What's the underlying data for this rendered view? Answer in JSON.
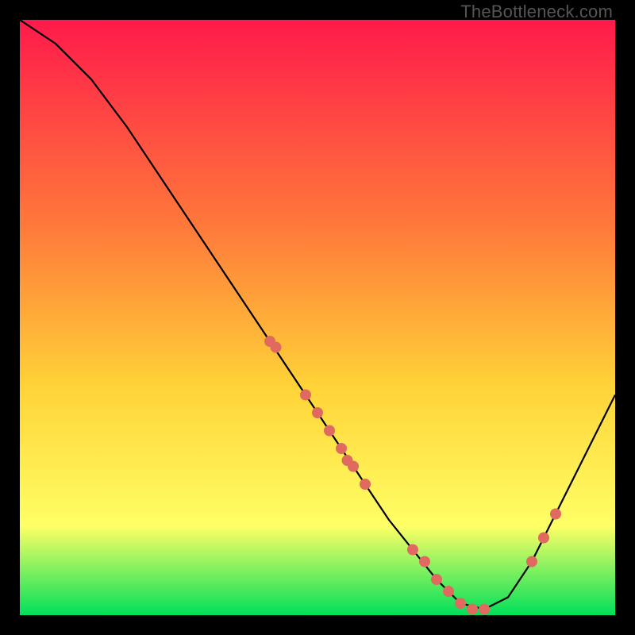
{
  "watermark": "TheBottleneck.com",
  "colors": {
    "grad_top": "#ff1a4b",
    "grad_mid1": "#ff7a3a",
    "grad_mid2": "#ffd438",
    "grad_mid3": "#ffff66",
    "grad_bottom": "#00e05a",
    "curve": "#000000",
    "marker": "#e06a60",
    "frame_bg": "#000000"
  },
  "chart_data": {
    "type": "line",
    "title": "",
    "xlabel": "",
    "ylabel": "",
    "xlim": [
      0,
      100
    ],
    "ylim": [
      0,
      100
    ],
    "grid": false,
    "legend": false,
    "series": [
      {
        "name": "bottleneck-curve",
        "x": [
          0,
          6,
          12,
          18,
          24,
          30,
          36,
          42,
          48,
          54,
          58,
          62,
          66,
          70,
          74,
          78,
          82,
          86,
          90,
          94,
          98,
          100
        ],
        "y": [
          100,
          96,
          90,
          82,
          73,
          64,
          55,
          46,
          37,
          28,
          22,
          16,
          11,
          6,
          2,
          1,
          3,
          9,
          17,
          25,
          33,
          37
        ]
      }
    ],
    "markers": {
      "name": "highlighted-points",
      "x": [
        42,
        43,
        48,
        50,
        52,
        54,
        55,
        56,
        58,
        66,
        68,
        70,
        72,
        74,
        76,
        78,
        86,
        88,
        90
      ],
      "y": [
        46,
        45,
        37,
        34,
        31,
        28,
        26,
        25,
        22,
        11,
        9,
        6,
        4,
        2,
        1,
        1,
        9,
        13,
        17
      ]
    }
  }
}
